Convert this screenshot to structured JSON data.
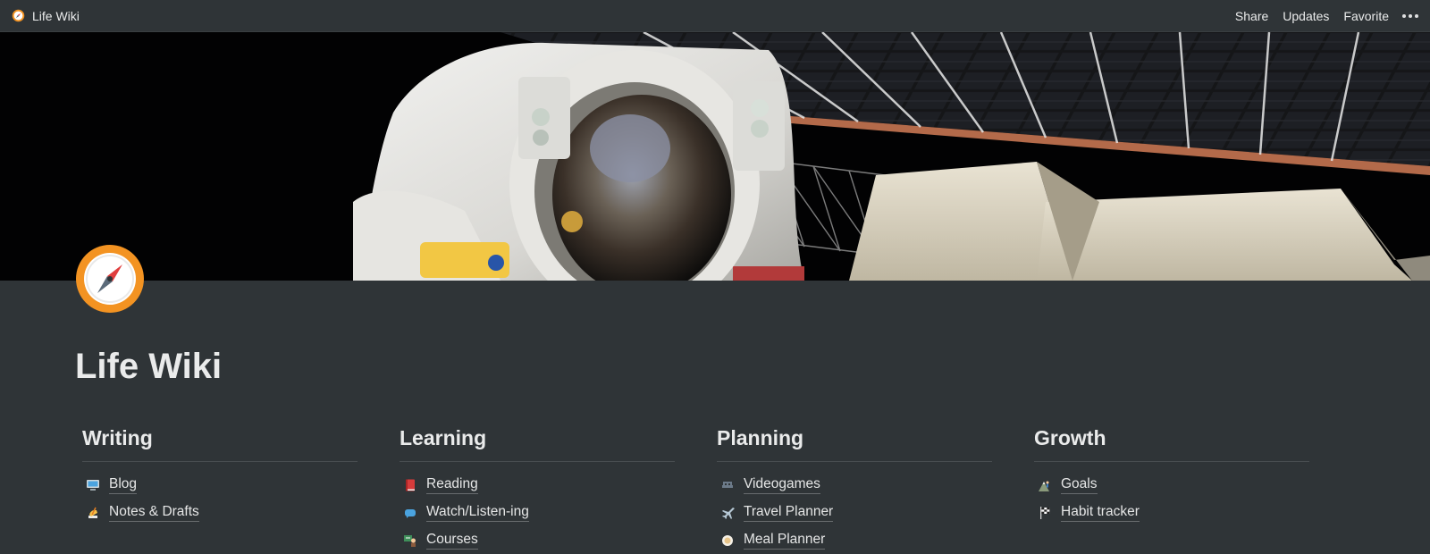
{
  "topbar": {
    "breadcrumb": "Life Wiki",
    "actions": {
      "share": "Share",
      "updates": "Updates",
      "favorite": "Favorite"
    }
  },
  "page": {
    "title": "Life Wiki",
    "icon": "compass-icon",
    "cover": "astronaut-space-station-photo"
  },
  "sections": [
    {
      "heading": "Writing",
      "items": [
        {
          "label": "Blog",
          "icon": "computer-icon"
        },
        {
          "label": "Notes & Drafts",
          "icon": "writing-hand-icon"
        }
      ]
    },
    {
      "heading": "Learning",
      "items": [
        {
          "label": "Reading",
          "icon": "book-icon"
        },
        {
          "label": "Watch/Listen-ing",
          "icon": "speech-bubble-icon"
        },
        {
          "label": "Courses",
          "icon": "teacher-icon"
        }
      ]
    },
    {
      "heading": "Planning",
      "items": [
        {
          "label": "Videogames",
          "icon": "alien-monster-icon"
        },
        {
          "label": "Travel Planner",
          "icon": "airplane-icon"
        },
        {
          "label": "Meal Planner",
          "icon": "plate-icon"
        }
      ]
    },
    {
      "heading": "Growth",
      "items": [
        {
          "label": "Goals",
          "icon": "mountain-climber-icon"
        },
        {
          "label": "Habit tracker",
          "icon": "checkered-flag-icon"
        }
      ]
    }
  ]
}
